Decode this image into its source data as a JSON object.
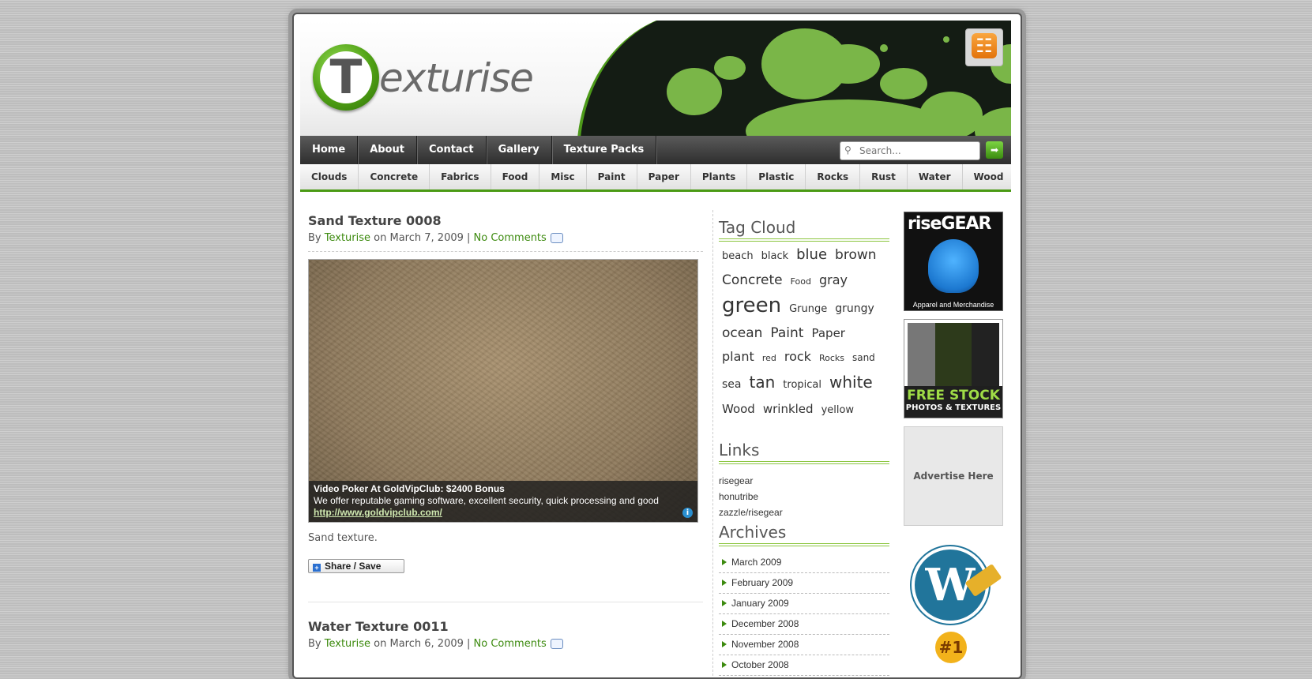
{
  "header": {
    "logo_letter": "T",
    "logo_text": "exturise",
    "rss_symbol": "☷"
  },
  "nav": {
    "items": [
      "Home",
      "About",
      "Contact",
      "Gallery",
      "Texture Packs"
    ],
    "search_placeholder": "Search...",
    "search_button": "➡"
  },
  "subnav": {
    "items": [
      "Clouds",
      "Concrete",
      "Fabrics",
      "Food",
      "Misc",
      "Paint",
      "Paper",
      "Plants",
      "Plastic",
      "Rocks",
      "Rust",
      "Water",
      "Wood"
    ]
  },
  "posts": [
    {
      "title": "Sand Texture 0008",
      "by": "By",
      "author": "Texturise",
      "on": "on March 7, 2009 |",
      "comments": "No Comments",
      "body": "Sand texture.",
      "share": "Share / Save",
      "ad": {
        "title": "Video Poker At GoldVipClub: $2400 Bonus",
        "desc": "We offer reputable gaming software, excellent security, quick processing and good",
        "url": "http://www.goldvipclub.com/",
        "info": "i"
      }
    },
    {
      "title": "Water Texture 0011",
      "by": "By",
      "author": "Texturise",
      "on": "on March 6, 2009 |",
      "comments": "No Comments"
    }
  ],
  "sidebar": {
    "tag_cloud_title": "Tag Cloud",
    "tags": [
      {
        "t": "beach",
        "s": 13
      },
      {
        "t": "black",
        "s": 13
      },
      {
        "t": "blue",
        "s": 18
      },
      {
        "t": "brown",
        "s": 17
      },
      {
        "t": "Concrete",
        "s": 17
      },
      {
        "t": "Food",
        "s": 11
      },
      {
        "t": "gray",
        "s": 16
      },
      {
        "t": "green",
        "s": 26
      },
      {
        "t": "Grunge",
        "s": 13
      },
      {
        "t": "grungy",
        "s": 14
      },
      {
        "t": "ocean",
        "s": 17
      },
      {
        "t": "Paint",
        "s": 17
      },
      {
        "t": "Paper",
        "s": 15
      },
      {
        "t": "plant",
        "s": 16
      },
      {
        "t": "red",
        "s": 11
      },
      {
        "t": "rock",
        "s": 16
      },
      {
        "t": "Rocks",
        "s": 11
      },
      {
        "t": "sand",
        "s": 12
      },
      {
        "t": "sea",
        "s": 14
      },
      {
        "t": "tan",
        "s": 20
      },
      {
        "t": "tropical",
        "s": 13
      },
      {
        "t": "white",
        "s": 20
      },
      {
        "t": "Wood",
        "s": 15
      },
      {
        "t": "wrinkled",
        "s": 15
      },
      {
        "t": "yellow",
        "s": 13
      }
    ],
    "links_title": "Links",
    "links": [
      "risegear",
      "honutribe",
      "zazzle/risegear"
    ],
    "archives_title": "Archives",
    "archives": [
      "March 2009",
      "February 2009",
      "January 2009",
      "December 2008",
      "November 2008",
      "October 2008"
    ]
  },
  "ads": {
    "risegear_title": "riseGEAR",
    "risegear_caption": "Apparel and Merchandise",
    "freestock_t1": "FREE STOCK",
    "freestock_t2": "PHOTOS & TEXTURES",
    "advertise": "Advertise Here",
    "wp_letter": "W",
    "badge_text": "#1"
  },
  "colors": {
    "accent_green": "#3c8a0e",
    "nav_dark": "#2e2e2e",
    "splash_green": "#7ab648"
  }
}
